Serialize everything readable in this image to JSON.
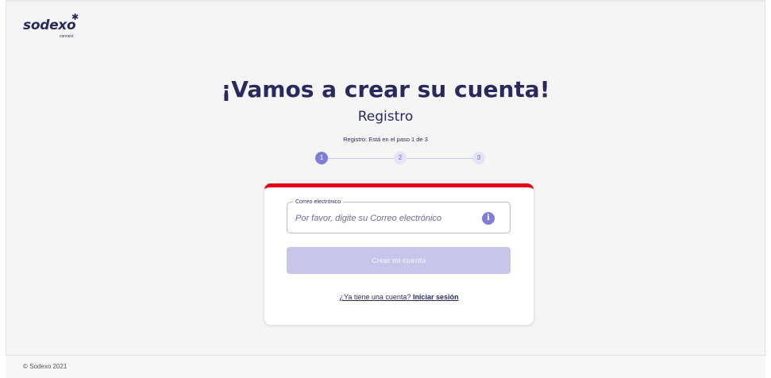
{
  "brand": {
    "name": "sodexo",
    "sub": "connect"
  },
  "header": {
    "title": "¡Vamos a crear su cuenta!",
    "subtitle": "Registro"
  },
  "stepper": {
    "status_text": "Registro: Está en el paso 1 de 3",
    "steps": [
      "1",
      "2",
      "3"
    ],
    "current": 1
  },
  "form": {
    "email": {
      "legend": "Correo electrónico",
      "placeholder": "Por favor, digite su Correo electrónico",
      "value": ""
    },
    "info_icon": "info-icon",
    "submit_label": "Crear mi cuenta",
    "login_prompt": "¿Ya tiene una cuenta?",
    "login_link": "Iniciar sesión"
  },
  "footer": {
    "copyright": "© Sodexo 2021"
  },
  "colors": {
    "brand_navy": "#2a295c",
    "accent_purple": "#7f7ed7",
    "card_top_border": "#e2001a",
    "button_disabled": "#c7c6ea"
  }
}
